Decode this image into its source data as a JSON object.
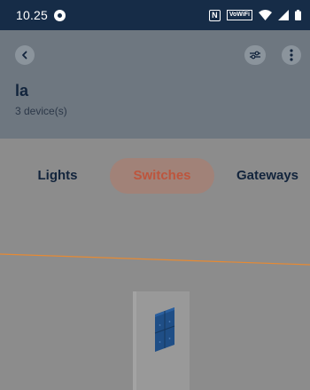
{
  "status_bar": {
    "time": "10.25",
    "vowifi": "VoWiFi",
    "nfc": "N"
  },
  "header": {
    "room_name": "la",
    "device_count": "3 device(s)"
  },
  "tabs": [
    {
      "label": "Lights"
    },
    {
      "label": "Switches",
      "active": true
    },
    {
      "label": "Gateways"
    }
  ],
  "colors": {
    "status_bar_bg": "#162c47",
    "active_tab_text": "#bd553d",
    "guide_line": "#e58a34",
    "switch_panel": "#1f4e86"
  },
  "icons": {
    "back": "chevron-left-icon",
    "settings": "sliders-icon",
    "more": "more-vertical-icon",
    "switch": "wall-switch-icon"
  }
}
